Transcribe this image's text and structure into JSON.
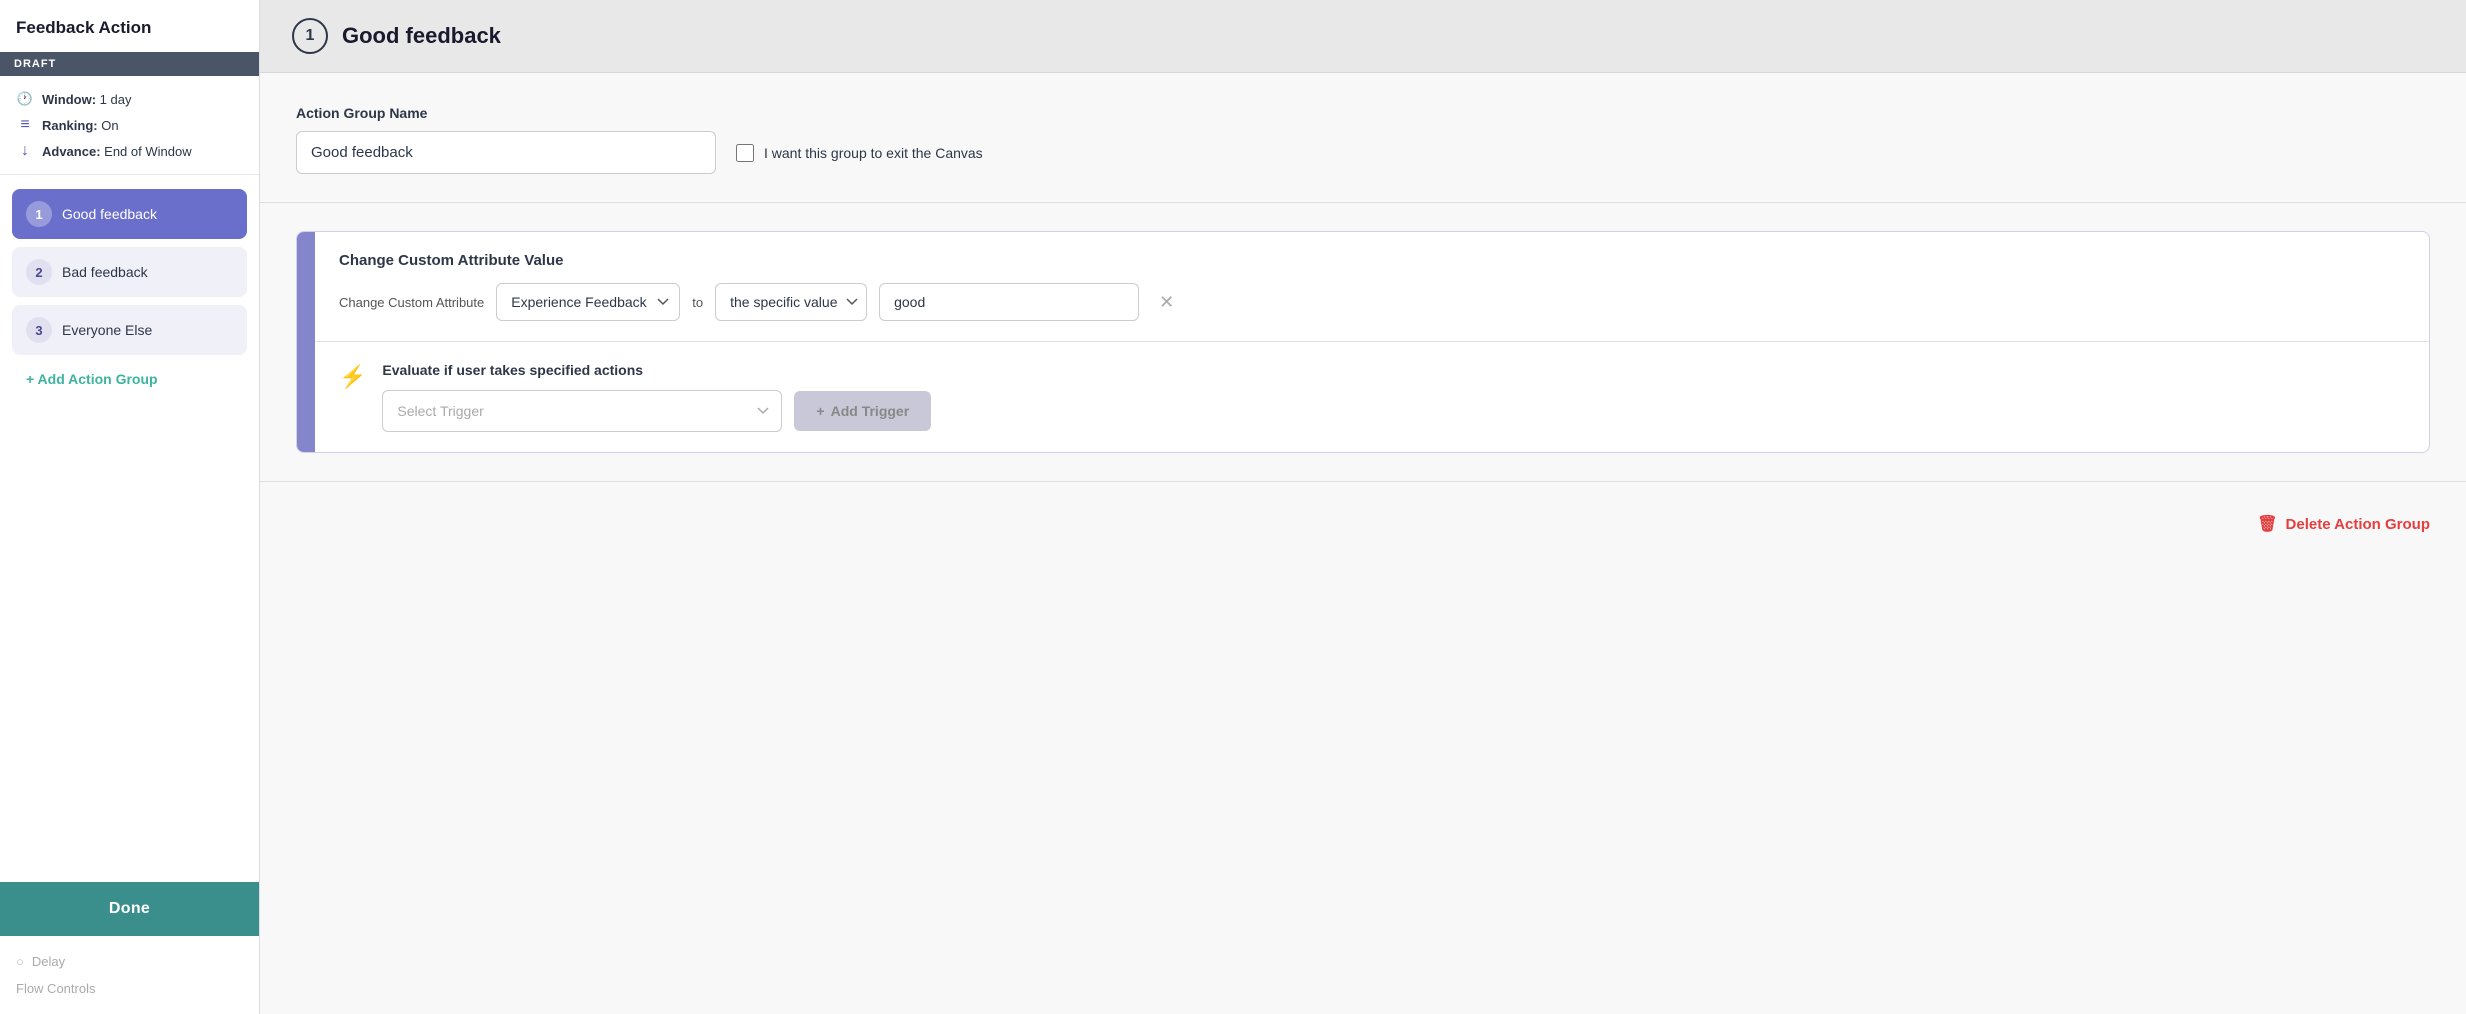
{
  "sidebar": {
    "title": "Feedback Action",
    "draft_badge": "DRAFT",
    "meta": [
      {
        "icon": "clock-icon",
        "label": "Window:",
        "value": "1 day"
      },
      {
        "icon": "ranking-icon",
        "label": "Ranking:",
        "value": "On"
      },
      {
        "icon": "advance-icon",
        "label": "Advance:",
        "value": "End of Window"
      }
    ],
    "groups": [
      {
        "number": "1",
        "label": "Good feedback",
        "active": true
      },
      {
        "number": "2",
        "label": "Bad feedback",
        "active": false
      },
      {
        "number": "3",
        "label": "Everyone Else",
        "active": false
      }
    ],
    "add_group_label": "+ Add Action Group",
    "done_label": "Done",
    "bottom": {
      "delay_label": "Delay",
      "flow_controls_label": "Flow Controls"
    }
  },
  "main": {
    "header": {
      "number": "1",
      "title": "Good feedback"
    },
    "action_group_name_label": "Action Group Name",
    "name_input_value": "Good feedback",
    "exit_canvas_label": "I want this group to exit the Canvas",
    "action_card": {
      "section_title": "Change Custom Attribute Value",
      "change_label": "Change Custom Attribute",
      "attribute_dropdown": "Experience Feedback",
      "to_label": "to",
      "value_type_dropdown": "the specific value",
      "value_input": "good",
      "evaluate_title": "Evaluate if user takes specified actions",
      "trigger_placeholder": "Select Trigger",
      "add_trigger_label": "+ Add Trigger"
    },
    "delete_label": "Delete Action Group"
  }
}
